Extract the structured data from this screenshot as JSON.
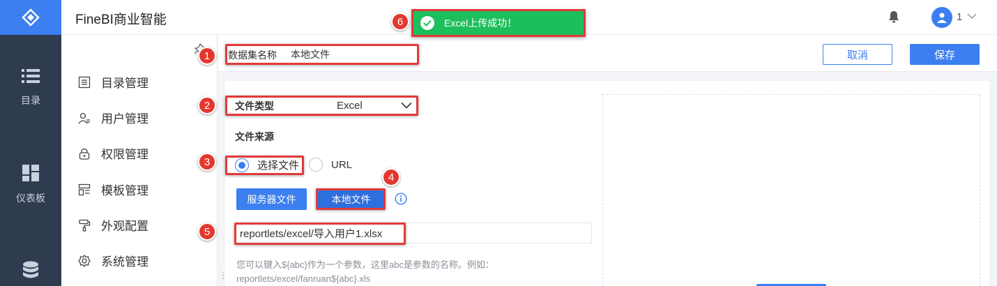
{
  "header": {
    "app_title": "FineBI商业智能",
    "user_name": "1"
  },
  "nav": {
    "items": [
      {
        "label": "目录",
        "icon": "list-icon"
      },
      {
        "label": "仪表板",
        "icon": "dashboard-icon"
      },
      {
        "label": "",
        "icon": "database-icon"
      }
    ]
  },
  "submenu": {
    "items": [
      {
        "label": "目录管理",
        "icon": "catalog-icon"
      },
      {
        "label": "用户管理",
        "icon": "user-icon"
      },
      {
        "label": "权限管理",
        "icon": "lock-icon"
      },
      {
        "label": "模板管理",
        "icon": "template-icon"
      },
      {
        "label": "外观配置",
        "icon": "paint-roller-icon"
      },
      {
        "label": "系统管理",
        "icon": "gear-icon"
      }
    ]
  },
  "toolbar": {
    "dataset_label": "数据集名称",
    "dataset_name": "本地文件",
    "cancel_label": "取消",
    "save_label": "保存"
  },
  "form": {
    "file_type_label": "文件类型",
    "file_type_value": "Excel",
    "file_source_label": "文件来源",
    "source_options": [
      {
        "label": "选择文件",
        "selected": true
      },
      {
        "label": "URL",
        "selected": false
      }
    ],
    "server_file_label": "服务器文件",
    "local_file_label": "本地文件",
    "file_path": "reportlets/excel/导入用户1.xlsx",
    "hint_line1": "您可以键入${abc}作为一个参数，这里abc是参数的名称。例如：",
    "hint_line2": "reportlets/excel/fanruan${abc}.xls"
  },
  "toast": {
    "message": "Excel上传成功！"
  },
  "annotations": [
    "1",
    "2",
    "3",
    "4",
    "5",
    "6"
  ],
  "colors": {
    "primary": "#3b7ff0",
    "nav_bg": "#2f3b4e",
    "toast_bg": "#1dbe5c",
    "annotation_red": "#e23a3a"
  }
}
